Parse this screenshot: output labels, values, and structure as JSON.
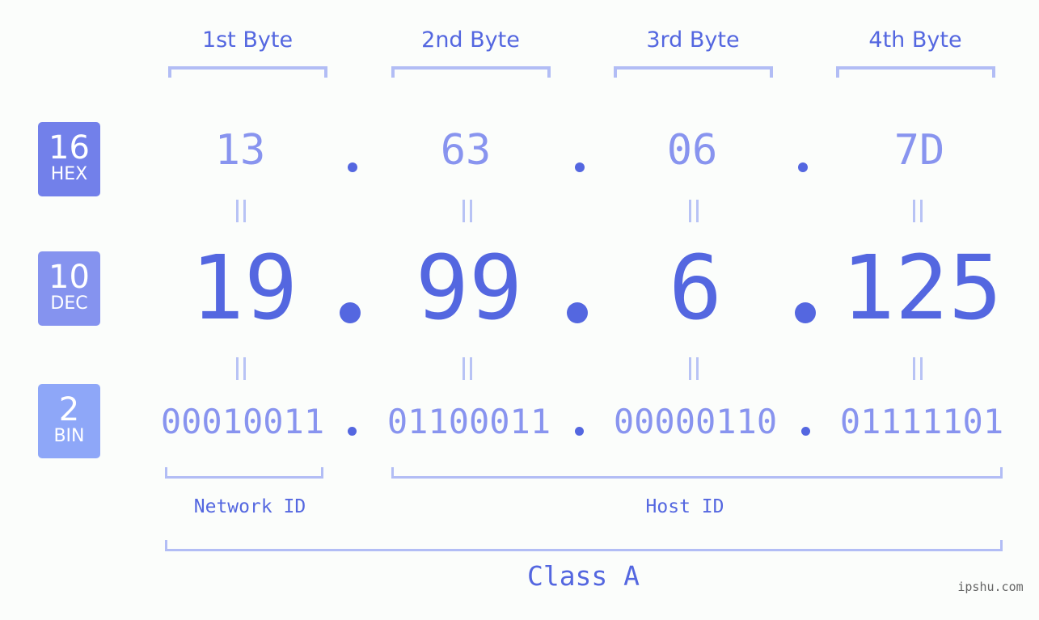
{
  "bytes": {
    "labels": [
      "1st Byte",
      "2nd Byte",
      "3rd Byte",
      "4th Byte"
    ]
  },
  "badges": {
    "hex": {
      "number": "16",
      "label": "HEX",
      "color": "#7280ea"
    },
    "dec": {
      "number": "10",
      "label": "DEC",
      "color": "#8593ef"
    },
    "bin": {
      "number": "2",
      "label": "BIN",
      "color": "#8ea7f8"
    }
  },
  "hex": {
    "values": [
      "13",
      "63",
      "06",
      "7D"
    ]
  },
  "dec": {
    "values": [
      "19",
      "99",
      "6",
      "125"
    ]
  },
  "bin": {
    "values": [
      "00010011",
      "01100011",
      "00000110",
      "01111101"
    ]
  },
  "segments": {
    "network_id": "Network ID",
    "host_id": "Host ID"
  },
  "class_label": "Class A",
  "watermark": "ipshu.com",
  "colors": {
    "primary": "#5467e0",
    "light": "#8894ef",
    "bracket": "#b2bdf5"
  }
}
